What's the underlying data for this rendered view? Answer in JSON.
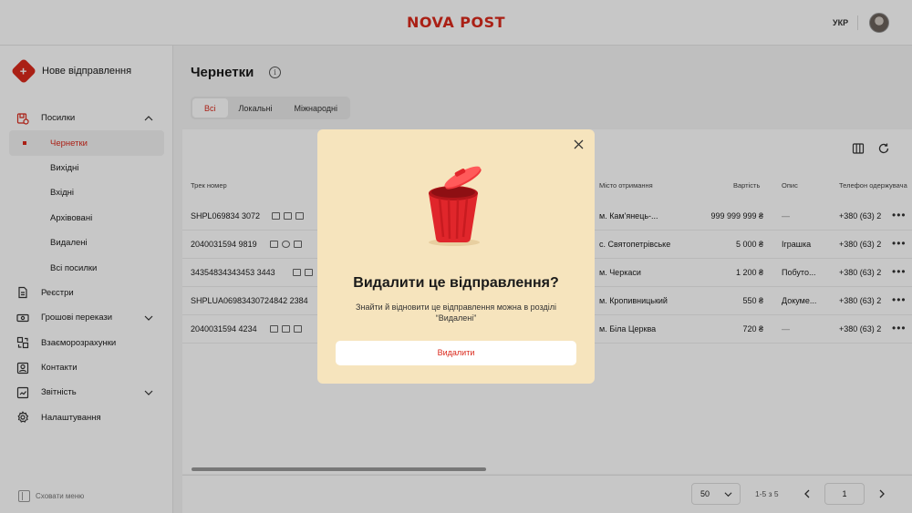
{
  "header": {
    "logo": "NOVA POST",
    "lang": "УКР"
  },
  "sidebar": {
    "new_shipment": "Нове відправлення",
    "items": [
      {
        "label": "Посилки",
        "icon": "parcel-icon",
        "expanded": true
      },
      {
        "label": "Реєстри",
        "icon": "document-icon"
      },
      {
        "label": "Грошові перекази",
        "icon": "money-icon"
      },
      {
        "label": "Взаєморозрахунки",
        "icon": "settlement-icon"
      },
      {
        "label": "Контакти",
        "icon": "contacts-icon"
      },
      {
        "label": "Звітність",
        "icon": "report-icon"
      },
      {
        "label": "Налаштування",
        "icon": "settings-icon"
      }
    ],
    "subitems": [
      "Чернетки",
      "Вихідні",
      "Вхідні",
      "Архівовані",
      "Видалені",
      "Всі посилки"
    ],
    "collapse": "Сховати меню"
  },
  "main": {
    "title": "Чернетки",
    "tabs": [
      "Всі",
      "Локальні",
      "Міжнародні"
    ],
    "columns": {
      "track": "Трек номер",
      "city": "Місто отримання",
      "cost": "Вартість",
      "desc": "Опис",
      "phone": "Телефон одержувача"
    },
    "rows": [
      {
        "track": "SHPL069834 3072",
        "city": "м. Кам'янець-...",
        "cost": "999 999 999 ₴",
        "desc": "—",
        "phone": "+380 (63) 2"
      },
      {
        "track": "2040031594 9819",
        "city": "с. Святопетрівське",
        "cost": "5 000 ₴",
        "desc": "Іграшка",
        "phone": "+380 (63) 2"
      },
      {
        "track": "34354834343453 3443",
        "city": "м. Черкаси",
        "cost": "1 200 ₴",
        "desc": "Побуто...",
        "phone": "+380 (63) 2"
      },
      {
        "track": "SHPLUA06983430724842 2384",
        "city": "м. Кропивницький",
        "cost": "550 ₴",
        "desc": "Докуме...",
        "phone": "+380 (63) 2"
      },
      {
        "track": "2040031594 4234",
        "city": "м. Біла Церква",
        "cost": "720 ₴",
        "desc": "—",
        "phone": "+380 (63) 2"
      }
    ]
  },
  "pagination": {
    "per_page": "50",
    "range": "1-5 з 5",
    "page": "1"
  },
  "modal": {
    "title": "Видалити це відправлення?",
    "text": "Знайти й відновити це відправлення можна в розділі “Видалені”",
    "button": "Видалити",
    "icon": "trash-bin-illustration"
  },
  "colors": {
    "accent": "#da291c",
    "modal_bg": "#f6e4bd"
  }
}
